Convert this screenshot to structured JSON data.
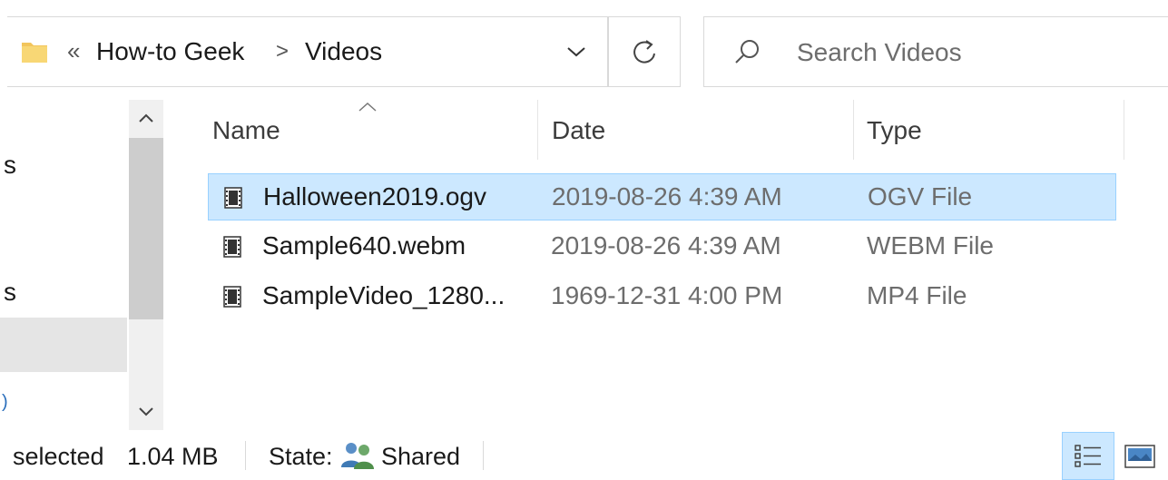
{
  "address": {
    "overflow_chevron": "«",
    "crumbs": [
      "How-to Geek",
      "Videos"
    ],
    "separator": ">",
    "folder_icon": "folder-icon",
    "dropdown_icon": "chevron-down-icon",
    "refresh_icon": "refresh-icon"
  },
  "search": {
    "placeholder": "Search Videos",
    "icon": "search-icon"
  },
  "nav": {
    "partial_labels": [
      "s",
      "s"
    ],
    "partial_link": ")"
  },
  "columns": [
    {
      "label": "Name"
    },
    {
      "label": "Date"
    },
    {
      "label": "Type"
    }
  ],
  "files": [
    {
      "name": "Halloween2019.ogv",
      "date": "2019-08-26 4:39 AM",
      "type": "OGV File",
      "selected": true
    },
    {
      "name": "Sample640.webm",
      "date": "2019-08-26 4:39 AM",
      "type": "WEBM File",
      "selected": false
    },
    {
      "name": "SampleVideo_1280...",
      "date": "1969-12-31 4:00 PM",
      "type": "MP4 File",
      "selected": false
    }
  ],
  "status": {
    "selected_label": "selected",
    "size": "1.04 MB",
    "state_label": "State:",
    "state_value": "Shared"
  },
  "colors": {
    "selection_fill": "#cce8ff",
    "selection_border": "#99d1ff",
    "folder": "#f2c55c"
  }
}
